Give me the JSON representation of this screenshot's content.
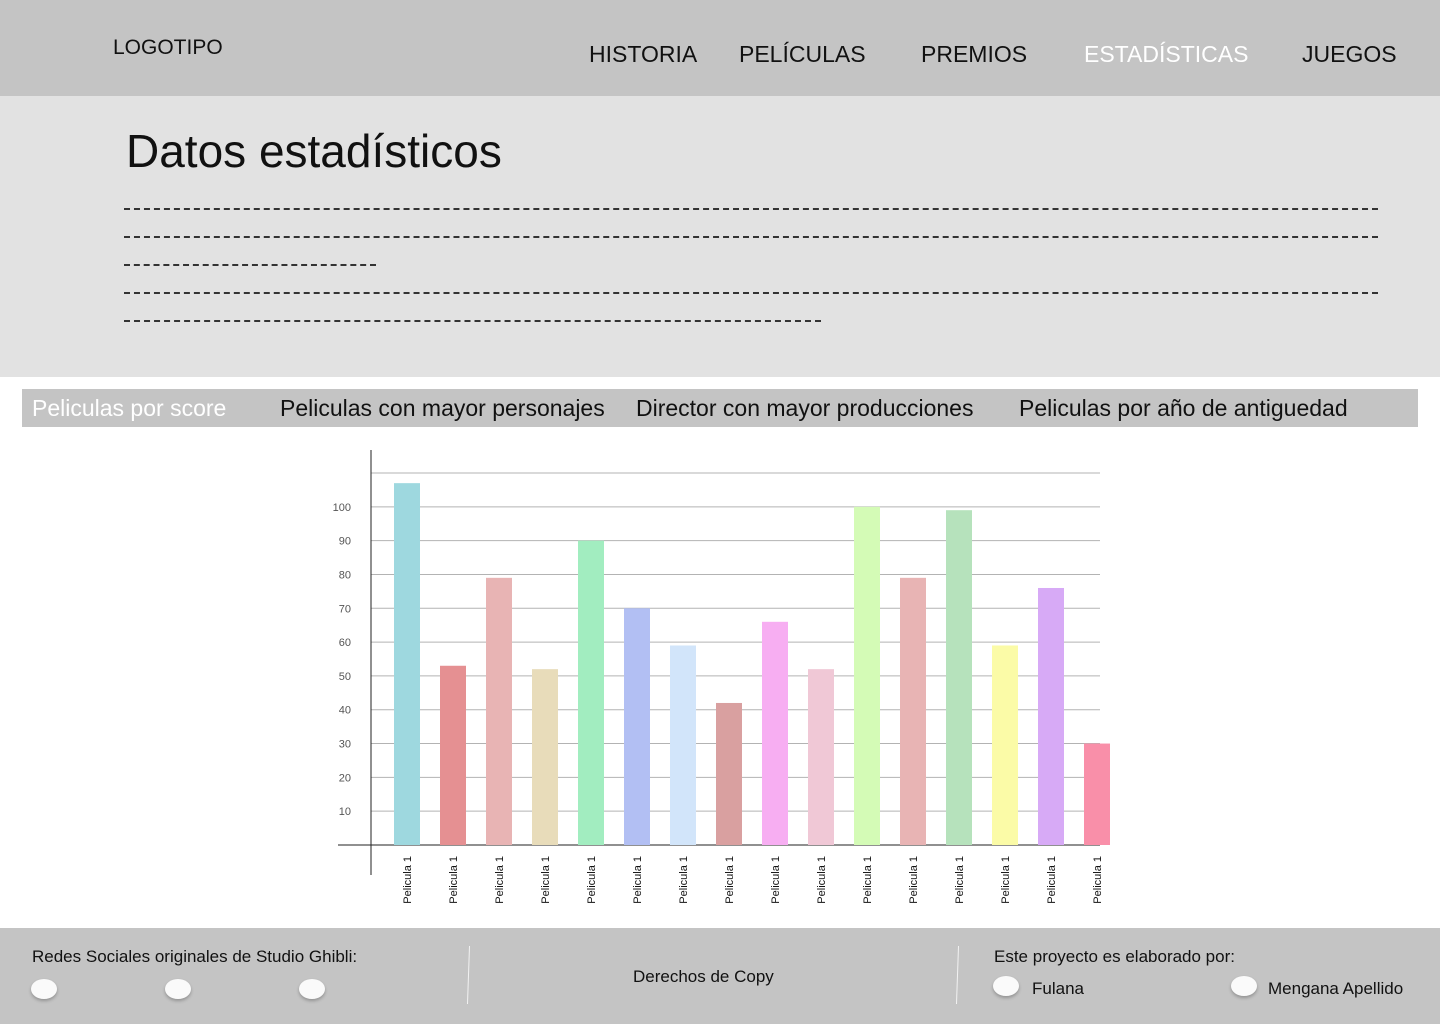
{
  "header": {
    "logo": "LOGOTIPO",
    "nav": [
      {
        "label": "HISTORIA"
      },
      {
        "label": "PELÍCULAS"
      },
      {
        "label": "PREMIOS"
      },
      {
        "label": "ESTADÍSTICAS",
        "active": true
      },
      {
        "label": "JUEGOS"
      }
    ]
  },
  "intro": {
    "title": "Datos estadísticos"
  },
  "tabs": [
    {
      "label": "Peliculas por score",
      "active": true
    },
    {
      "label": "Peliculas con mayor personajes"
    },
    {
      "label": "Director con mayor producciones"
    },
    {
      "label": "Peliculas por año de antiguedad"
    }
  ],
  "chart_data": {
    "type": "bar",
    "title": "",
    "xlabel": "",
    "ylabel": "",
    "ylim": [
      0,
      110
    ],
    "yticks": [
      10,
      20,
      30,
      40,
      50,
      60,
      70,
      80,
      90,
      100
    ],
    "categories": [
      "Pelicula 1",
      "Pelicula 1",
      "Pelicula 1",
      "Pelicula 1",
      "Pelicula 1",
      "Pelicula 1",
      "Pelicula 1",
      "Pelicula 1",
      "Pelicula 1",
      "Pelicula 1",
      "Pelicula 1",
      "Pelicula 1",
      "Pelicula 1",
      "Pelicula 1",
      "Pelicula 1",
      "Pelicula 1"
    ],
    "values": [
      107,
      53,
      79,
      52,
      90,
      70,
      59,
      42,
      66,
      52,
      100,
      79,
      99,
      59,
      76,
      30
    ],
    "colors": [
      "#9ed8df",
      "#e59092",
      "#e8b4b4",
      "#e8dcba",
      "#a2edc0",
      "#b2bff3",
      "#d2e5fa",
      "#d9a0a0",
      "#f7aef2",
      "#f0c8d6",
      "#d4fbb6",
      "#e8b4b4",
      "#b6e2bc",
      "#fbfba7",
      "#d7aaf6",
      "#f98fa9"
    ],
    "grid": true
  },
  "footer": {
    "social_title": "Redes Sociales originales de Studio Ghibli:",
    "copyright": "Derechos de Copy",
    "authors_title": "Este proyecto es elaborado por:",
    "authors": [
      "Fulana",
      "Mengana Apellido"
    ]
  }
}
